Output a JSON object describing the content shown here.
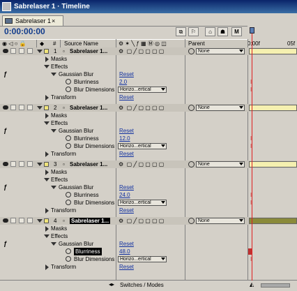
{
  "window": {
    "title": "Sabrelaser 1 · Timeline"
  },
  "tab": {
    "label": "Sabrelaser 1",
    "close": "×"
  },
  "timecode": "0:00:00:00",
  "ruler": {
    "start": "0:00f",
    "mark": "05f"
  },
  "header": {
    "num": "#",
    "source_name": "Source Name",
    "parent": "Parent"
  },
  "layers": [
    {
      "num": "1",
      "name": "Sabrelaser 1...",
      "parent": "None",
      "blurriness": "2.0",
      "blur_dimensions": "Horizo...ertical",
      "selected": false
    },
    {
      "num": "2",
      "name": "Sabrelaser 1...",
      "parent": "None",
      "blurriness": "12.0",
      "blur_dimensions": "Horizo...ertical",
      "selected": false
    },
    {
      "num": "3",
      "name": "Sabrelaser 1...",
      "parent": "None",
      "blurriness": "24.0",
      "blur_dimensions": "Horizo...ertical",
      "selected": false
    },
    {
      "num": "4",
      "name": "Sabrelaser 1...",
      "parent": "None",
      "blurriness": "48.0",
      "blur_dimensions": "Horizo...ertical",
      "selected": true
    }
  ],
  "labels": {
    "masks": "Masks",
    "effects": "Effects",
    "gaussian_blur": "Gaussian Blur",
    "blurriness": "Blurriness",
    "blur_dimensions": "Blur Dimensions",
    "transform": "Transform",
    "reset": "Reset"
  },
  "bottom": {
    "switches_modes": "Switches / Modes"
  },
  "colors": {
    "title_bar": "#0a246a",
    "timecode": "#123c8c",
    "cti": "#e02020",
    "layer_bar": "#f5f0b0",
    "selected_bar": "#8a8a3a"
  }
}
